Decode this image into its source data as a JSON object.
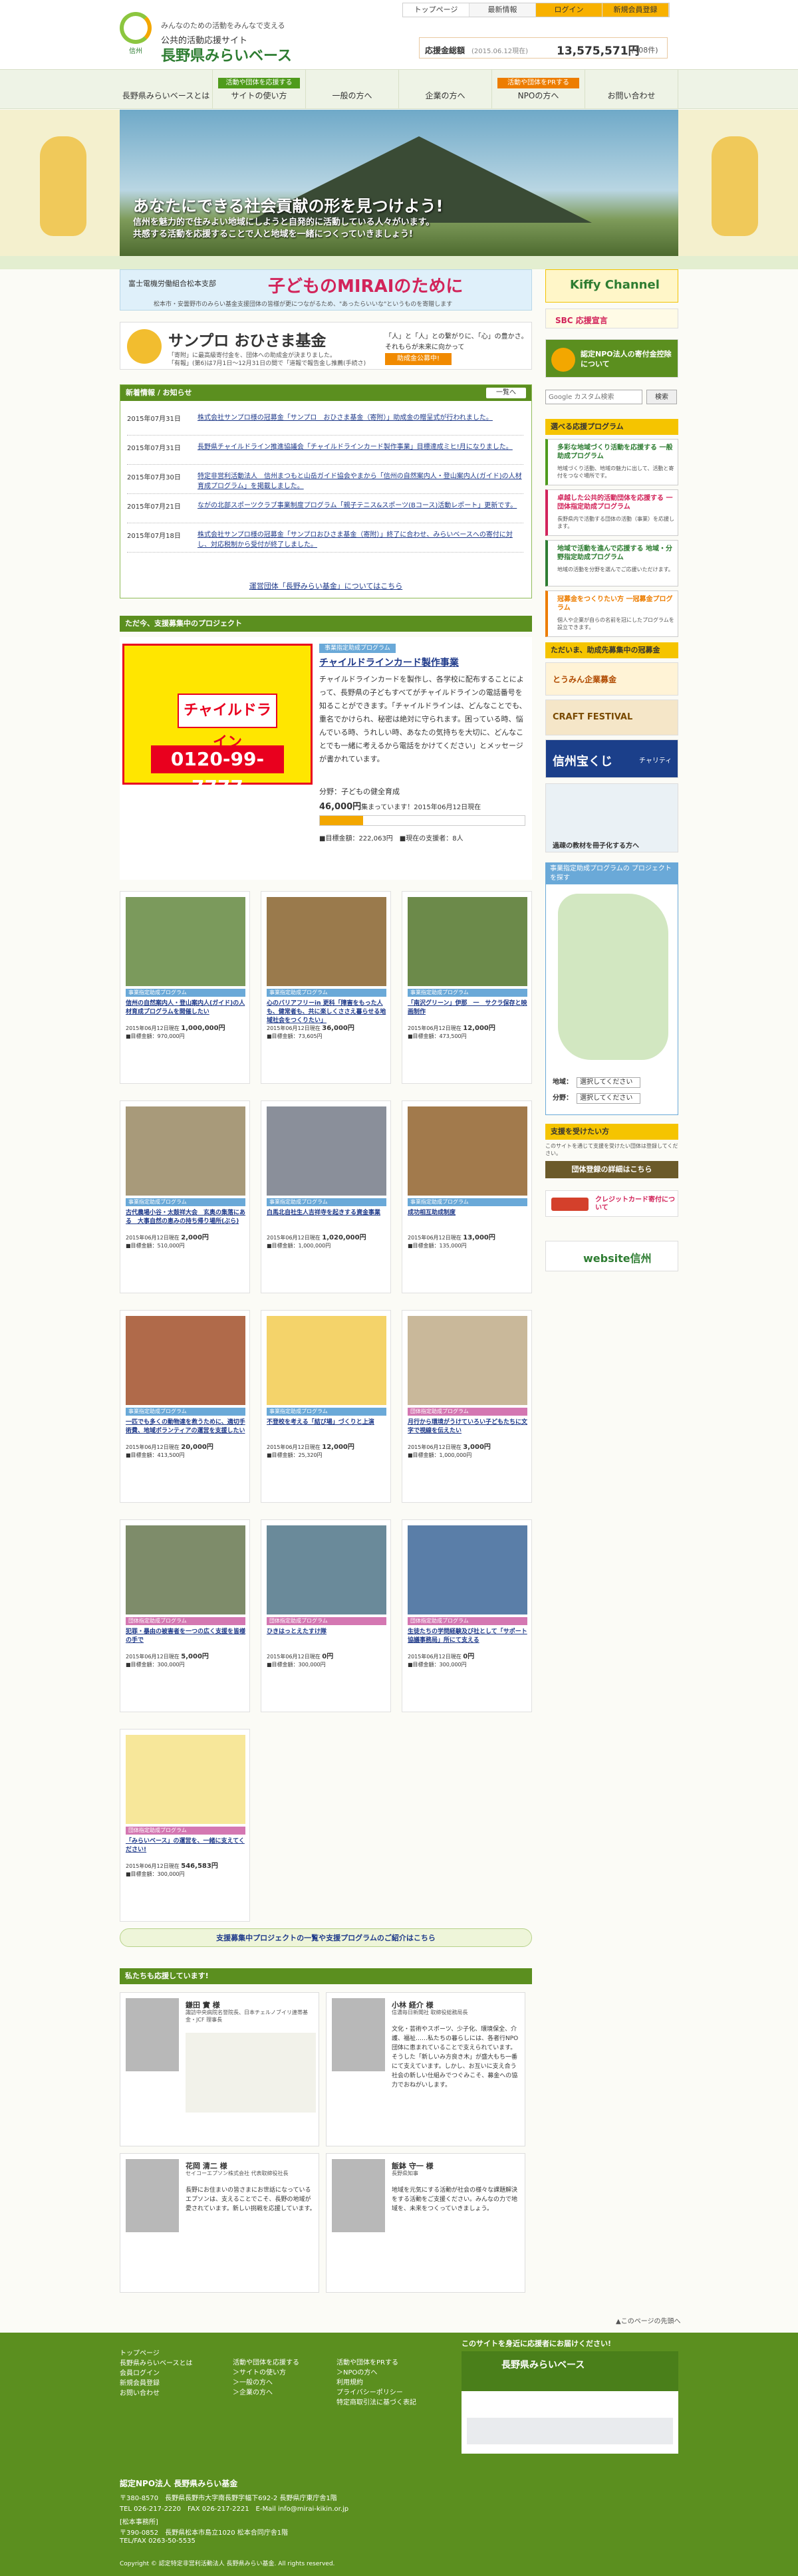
{
  "header": {
    "logo_caption": "信州",
    "tagline": "みんなのための活動をみんなで支える",
    "site_line1": "公共的活動応援サイト",
    "site_name": "長野県みらいベース",
    "topnav": [
      "トップページ",
      "最新情報",
      "ログイン",
      "新規会員登録"
    ],
    "donate_label": "応援金総額",
    "donate_date": "(2015.06.12現在)",
    "donate_amount": "13,575,571円",
    "donate_count": "(408件)"
  },
  "mainnav": [
    {
      "label": "長野県みらいベースとは",
      "bar": ""
    },
    {
      "label": "サイトの使い方",
      "bar": "活動や団体を応援する"
    },
    {
      "label": "一般の方へ",
      "bar": ""
    },
    {
      "label": "企業の方へ",
      "bar": ""
    },
    {
      "label": "NPOの方へ",
      "bar": "活動や団体をPRする"
    },
    {
      "label": "お問い合わせ",
      "bar": ""
    }
  ],
  "hero": {
    "title": "あなたにできる社会貢献の形を見つけよう!",
    "line1": "信州を魅力的で住みよい地域にしようと自発的に活動している人々がいます。",
    "line2": "共感する活動を応援することで人と地域を一緒につくっていきましょう!"
  },
  "banner1": {
    "sponsor": "富士電機労働組合松本支部",
    "title": "子どものMIRAIのために",
    "desc": "松本市・安曇野市のみらい基金支援団体の皆様が更につながるため、\"あったらいいな\"というものを寄贈します"
  },
  "banner2": {
    "title": "サンプロ おひさま基金",
    "sub1": "「寄附」に最高級寄付金を、団体への助成金が決まりました。",
    "sub2": "「有報」(第6)は7月1日〜12月31日の間で「道報で報告金し推薦(手続さ)",
    "r1": "「人」と「人」との繋がりに、「心」の豊かさ。",
    "r2": "それもらが未来に向かって",
    "btn": "助成金公募中!"
  },
  "news": {
    "heading": "新着情報 / お知らせ",
    "more": "一覧へ",
    "items": [
      {
        "date": "2015年07月31日",
        "text": "株式会社サンプロ様の冠募金「サンプロ　おひさま基金（寄附）」助成金の贈呈式が行われました。"
      },
      {
        "date": "2015年07月31日",
        "text": "長野県チャイルドライン推進協議会「チャイルドラインカード製作事業」目標達成ミヒ!月になりました。"
      },
      {
        "date": "2015年07月30日",
        "text": "特定非営利活動法人　信州まつもと山岳ガイド協会やまから「信州の自然案内人・登山案内人(ガイド)の人材育成プログラム」を掲載しました。"
      },
      {
        "date": "2015年07月21日",
        "text": "ながの北部スポーツクラブ事業制度プログラム「親子テニス&スポーツ(Bコース)活動レポート」更新です。"
      },
      {
        "date": "2015年07月18日",
        "text": "株式会社サンプロ様の冠募金「サンプロおひさま基金（寄附）」終了に合わせ、みらいベースへの寄付に対し、対応税制から受付が終了しました。"
      }
    ],
    "footer": "運営団体「長野みらい基金」についてはこちら"
  },
  "featured": {
    "heading": "ただ今、支援募集中のプロジェクト",
    "img_text": "チャイルドライン",
    "img_phone": "0120-99-7777",
    "tag": "事業指定助成プログラム",
    "title": "チャイルドラインカード製作事業",
    "desc": "チャイルドラインカードを製作し、各学校に配布することによって、長野県の子どもすべてがチャイルドラインの電話番号を知ることができます。「チャイルドラインは、どんなことでも、重名でかけられ、秘密は絶対に守られます。困っている時、悩んでいる時、うれしい時、あなたの気持ちを大切に、どんなことでも一緒に考えるから電話をかけてください」とメッセージが書かれています。",
    "category": "分野：子どもの健全育成",
    "amount": "46,000円",
    "amount_suffix": "集まっています！2015年06月12日現在",
    "progress_percent": 21,
    "meta": "■目標金額：222,063円　■現在の支援者：8人"
  },
  "cards": [
    {
      "tag": "事業指定助成プログラム",
      "title": "信州の自然案内人・登山案内人(ガイド)の人材育成プログラムを開催したい",
      "meta": "2015年06月12日現在",
      "amount": "1,000,000円",
      "goal": "■目標金額：970,000円",
      "kind": "b"
    },
    {
      "tag": "事業指定助成プログラム",
      "title": "心のバリアフリーin 更科「障害をもった人も、健常者も、共に楽しくささえ暮らせる地域社会をつくりたい」",
      "meta": "2015年06月12日現在",
      "amount": "36,000円",
      "goal": "■目標金額：73,605円",
      "kind": "b"
    },
    {
      "tag": "事業指定助成プログラム",
      "title": "「南沢グリーン」伊那　一　サクラ保存と映画制作",
      "meta": "2015年06月12日現在",
      "amount": "12,000円",
      "goal": "■目標金額：473,500円",
      "kind": "b"
    },
    {
      "tag": "事業指定助成プログラム",
      "title": "古代農場小谷・太鼓祥大会　玄奥の集落にある　大事自然の恵みの持ち帰り場所(ぶら)",
      "meta": "2015年06月12日現在",
      "amount": "2,000円",
      "goal": "■目標金額：510,000円",
      "kind": "b"
    },
    {
      "tag": "事業指定助成プログラム",
      "title": "白馬北自社生人吉祥寺を起きする資金事業",
      "meta": "2015年06月12日現在",
      "amount": "1,020,000円",
      "goal": "■目標金額：1,000,000円",
      "kind": "b"
    },
    {
      "tag": "事業指定助成プログラム",
      "title": "成功相互助成制度",
      "meta": "2015年06月12日現在",
      "amount": "13,000円",
      "goal": "■目標金額：135,000円",
      "kind": "b"
    },
    {
      "tag": "事業指定助成プログラム",
      "title": "一匹でも多くの動物達を救うために、適切手術費、地域ボランティアの運営を支援したい",
      "meta": "2015年06月12日現在",
      "amount": "20,000円",
      "goal": "■目標金額：413,500円",
      "kind": "b"
    },
    {
      "tag": "事業指定助成プログラム",
      "title": "不登校を考える「結び場」づくりと上演",
      "meta": "2015年06月12日現在",
      "amount": "12,000円",
      "goal": "■目標金額：25,320円",
      "kind": "b"
    },
    {
      "tag": "団体指定助成プログラム",
      "title": "月行から環境がうけていろい子どもたちに文字で視線を伝えたい",
      "meta": "2015年06月12日現在",
      "amount": "3,000円",
      "goal": "■目標金額：1,000,000円",
      "kind": "p"
    },
    {
      "tag": "団体指定助成プログラム",
      "title": "犯罪・暴由の被害者を一つの広く支援を皆様の手で",
      "meta": "2015年06月12日現在",
      "amount": "5,000円",
      "goal": "■目標金額：300,000円",
      "kind": "p"
    },
    {
      "tag": "団体指定助成プログラム",
      "title": "ひきはっとえたすけ隊",
      "meta": "2015年06月12日現在",
      "amount": "0円",
      "goal": "■目標金額：300,000円",
      "kind": "p"
    },
    {
      "tag": "団体指定助成プログラム",
      "title": "生徒たちの学問経験及び社として「サポート協議事務局」所にて支える",
      "meta": "2015年06月12日現在",
      "amount": "0円",
      "goal": "■目標金額：300,000円",
      "kind": "p"
    },
    {
      "tag": "団体指定助成プログラム",
      "title": "「みらいベース」の運営を、一緒に支えてください!",
      "meta": "2015年06月12日現在",
      "amount": "546,583円",
      "goal": "■目標金額：300,000円",
      "kind": "p"
    }
  ],
  "all_projects": "支援募集中プロジェクトの一覧や支援プログラムのご紹介はこちら",
  "supporters": {
    "heading": "私たちも応援しています!",
    "items": [
      {
        "name": "鎌田 實 様",
        "role": "諏訪中央病院名誉院長、日本チェルノブイリ連帯基金・JCF 理事長",
        "text": ""
      },
      {
        "name": "小林 経介 様",
        "role": "信濃毎日新聞社 取締役総務局長",
        "text": "文化・芸術やスポーツ、少子化、環境保全、介護、福祉……私たちの暮らしには、各者行NPO団体に恵まれていることで支えられています。そうした「新しいみ方良き木」が盛大もち一番にて支えています。しかし、お互いに支え合う社会の新しい仕組みでつぐみこそ、募金への協力でおねがいします。"
      },
      {
        "name": "花岡 清二 様",
        "role": "セイコーエプソン株式会社 代表取締役社長",
        "text": "長野にお住まいの皆さまにお世話になっているエプソンは、支えることでこそ、長野の地域が愛されています。新しい挑戦を応援しています。"
      },
      {
        "name": "飯鉢 守一 様",
        "role": "長野県知事",
        "text": "地域を元気にする活動が社会の様々な課題解決をする活動をご支援ください。みんなの力で地域を、未来をつくっていきましょう。"
      }
    ]
  },
  "back_to_top": "▲このページの先頭へ",
  "right": {
    "kiffy": "Kiffy Channel",
    "sbc": "SBC 応援宣言",
    "npo_btn": "認定NPO法人の寄付金控除について",
    "search_placeholder": "Google カスタム検索",
    "search_btn": "検索",
    "program_head": "選べる応援プログラム",
    "programs": [
      {
        "title": "多彩な地域づくり活動を応援する\n一般助成プログラム",
        "sub": "地域づくり活動、地域の魅力に出して、活動と寄付をつなぐ場所です。"
      },
      {
        "title": "卓越した公共的活動団体を応援する\n一団体指定助成プログラム",
        "sub": "長野県内で活動する団体の活動（事業）を応援します。"
      },
      {
        "title": "地域で活動を進んで応援する\n地域・分野指定助成プログラム",
        "sub": "地域の活動を分野を選んでご応援いただけます。"
      },
      {
        "title": "冠募金をつくりたい方\n一冠募金プログラム",
        "sub": "個人や企業が自らの名前を冠にしたプログラムを設立できます。"
      }
    ],
    "sponsor_head": "ただいま、助成先募集中の冠募金",
    "s1": "とうみん企業募金",
    "s2": "CRAFT FESTIVAL",
    "s3": "信州宝くじ",
    "s4": "チャリティ",
    "s5": "過疎の教材を冊子化する方へ",
    "map_head": "事業指定助成プログラムの\nプロジェクトを探す",
    "map_area": "地域：",
    "map_field": "分野：",
    "map_select": "選択してください",
    "support_head": "支援を受けたい方",
    "support_txt": "このサイトを通じて支援を受けたい団体は登録してください。",
    "support_btn": "団体登録の詳細はこちら",
    "card_btn": "クレジットカード寄付について",
    "website": "website信州"
  },
  "footer": {
    "col1": [
      "トップページ",
      "長野県みらいベースとは",
      "会員ログイン",
      "新規会員登録",
      "お問い合わせ"
    ],
    "col2": [
      "活動や団体を応援する",
      "＞サイトの使い方",
      "＞一般の方へ",
      "＞企業の方へ"
    ],
    "col3": [
      "活動や団体をPRする",
      "＞NPOの方へ",
      "利用規約",
      "プライバシーポリシー",
      "特定商取引法に基づく表記"
    ],
    "fb_title": "このサイトを身近に応援者にお届けください!",
    "fb_page": "長野県みらいベース",
    "org": "認定NPO法人 長野県みらい基金",
    "addr1": "〒380-8570　長野県長野市大字南長野字幅下692-2 長野県庁東庁舎1階",
    "addr2": "TEL 026-217-2220　FAX 026-217-2221　E-Mail info@mirai-kikin.or.jp",
    "addr3": "[松本事務所]",
    "addr4": "〒390-0852　長野県松本市島立1020 松本合同庁舎1階",
    "addr5": "TEL/FAX 0263-50-5535",
    "copy": "Copyright © 認定特定非営利活動法人 長野県みらい基金. All rights reserved."
  }
}
